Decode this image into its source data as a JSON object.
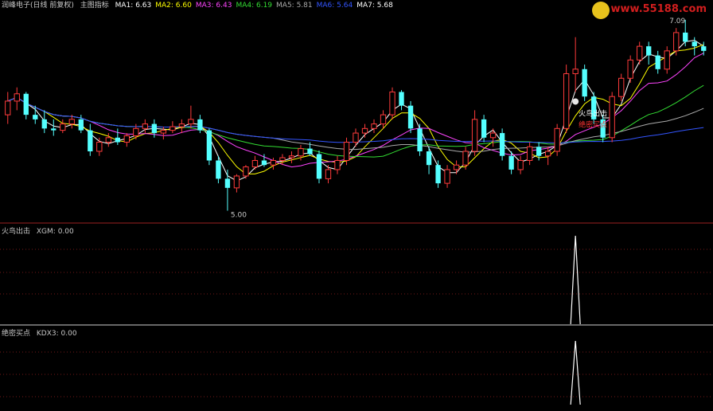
{
  "colors": {
    "up": "#ff3b3b",
    "down": "#54ffff",
    "frame": "#9c2020",
    "text": "#c8c8c8",
    "ma1": "#ffffff",
    "ma2": "#ffff00",
    "ma3": "#ff44ff",
    "ma4": "#33dd33",
    "ma5": "#aaaaaa",
    "ma6": "#3355ff",
    "ma7": "#ffffff",
    "signal": "#ffffff"
  },
  "header": {
    "stock": "润峰电子(日线 前复权)",
    "indicator": "主图指标",
    "ma_labels": [
      {
        "text": "MA1: 6.63",
        "color": "#ffffff"
      },
      {
        "text": "MA2: 6.60",
        "color": "#ffff00"
      },
      {
        "text": "MA3: 6.43",
        "color": "#ff44ff"
      },
      {
        "text": "MA4: 6.19",
        "color": "#33dd33"
      },
      {
        "text": "MA5: 5.81",
        "color": "#aaaaaa"
      },
      {
        "text": "MA6: 5.64",
        "color": "#3355ff"
      },
      {
        "text": "MA7: 5.68",
        "color": "#ffffff"
      }
    ]
  },
  "watermark": "www.55188.com",
  "annotations": {
    "high_label": "7.09",
    "low_label": "5.00",
    "signal1_label": "火鸟出击",
    "signal2_label": "绝密买点"
  },
  "panels": {
    "sub1": {
      "name": "火鸟出击",
      "value_label": "XGM: 0.00"
    },
    "sub2": {
      "name": "绝密买点",
      "value_label": "KDX3: 0.00"
    }
  },
  "chart_data": [
    {
      "type": "candlestick",
      "title": "润峰电子(日线 前复权)",
      "ylim": [
        4.9,
        7.15
      ],
      "candles": [
        [
          6.05,
          6.3,
          5.95,
          6.2
        ],
        [
          6.2,
          6.35,
          6.1,
          6.28
        ],
        [
          6.28,
          6.3,
          6.0,
          6.05
        ],
        [
          6.05,
          6.15,
          5.95,
          6.0
        ],
        [
          6.0,
          6.1,
          5.85,
          5.9
        ],
        [
          5.9,
          6.0,
          5.82,
          5.88
        ],
        [
          5.88,
          6.0,
          5.85,
          5.95
        ],
        [
          5.95,
          6.05,
          5.9,
          6.0
        ],
        [
          6.0,
          6.05,
          5.85,
          5.88
        ],
        [
          5.88,
          5.95,
          5.6,
          5.65
        ],
        [
          5.65,
          5.8,
          5.6,
          5.75
        ],
        [
          5.75,
          5.85,
          5.7,
          5.8
        ],
        [
          5.8,
          5.9,
          5.72,
          5.75
        ],
        [
          5.75,
          5.85,
          5.7,
          5.82
        ],
        [
          5.82,
          5.95,
          5.78,
          5.9
        ],
        [
          5.9,
          6.0,
          5.85,
          5.95
        ],
        [
          5.95,
          6.0,
          5.8,
          5.85
        ],
        [
          5.85,
          5.92,
          5.78,
          5.88
        ],
        [
          5.88,
          5.98,
          5.85,
          5.92
        ],
        [
          5.92,
          6.0,
          5.85,
          5.95
        ],
        [
          5.95,
          6.15,
          5.9,
          6.0
        ],
        [
          6.0,
          6.05,
          5.85,
          5.88
        ],
        [
          5.88,
          5.9,
          5.5,
          5.55
        ],
        [
          5.55,
          5.6,
          5.3,
          5.35
        ],
        [
          5.35,
          5.45,
          5.0,
          5.25
        ],
        [
          5.25,
          5.4,
          5.2,
          5.38
        ],
        [
          5.38,
          5.5,
          5.35,
          5.48
        ],
        [
          5.48,
          5.6,
          5.45,
          5.55
        ],
        [
          5.55,
          5.62,
          5.48,
          5.5
        ],
        [
          5.5,
          5.58,
          5.45,
          5.55
        ],
        [
          5.55,
          5.62,
          5.5,
          5.58
        ],
        [
          5.58,
          5.65,
          5.52,
          5.6
        ],
        [
          5.6,
          5.72,
          5.55,
          5.68
        ],
        [
          5.68,
          5.75,
          5.6,
          5.62
        ],
        [
          5.62,
          5.66,
          5.3,
          5.35
        ],
        [
          5.35,
          5.5,
          5.3,
          5.45
        ],
        [
          5.45,
          5.6,
          5.4,
          5.55
        ],
        [
          5.55,
          5.8,
          5.5,
          5.75
        ],
        [
          5.75,
          5.9,
          5.7,
          5.85
        ],
        [
          5.85,
          5.95,
          5.8,
          5.9
        ],
        [
          5.9,
          6.0,
          5.85,
          5.95
        ],
        [
          5.95,
          6.1,
          5.9,
          6.05
        ],
        [
          6.05,
          6.35,
          6.0,
          6.3
        ],
        [
          6.3,
          6.32,
          6.1,
          6.15
        ],
        [
          6.15,
          6.2,
          5.85,
          5.9
        ],
        [
          5.9,
          5.95,
          5.6,
          5.65
        ],
        [
          5.65,
          5.7,
          5.4,
          5.5
        ],
        [
          5.5,
          5.55,
          5.25,
          5.3
        ],
        [
          5.3,
          5.5,
          5.25,
          5.45
        ],
        [
          5.45,
          5.55,
          5.4,
          5.5
        ],
        [
          5.5,
          5.7,
          5.45,
          5.65
        ],
        [
          5.65,
          6.1,
          5.6,
          6.0
        ],
        [
          6.0,
          6.05,
          5.75,
          5.8
        ],
        [
          5.8,
          5.9,
          5.7,
          5.85
        ],
        [
          5.85,
          5.9,
          5.55,
          5.6
        ],
        [
          5.6,
          5.65,
          5.4,
          5.45
        ],
        [
          5.45,
          5.6,
          5.4,
          5.55
        ],
        [
          5.55,
          5.75,
          5.5,
          5.7
        ],
        [
          5.7,
          5.75,
          5.55,
          5.6
        ],
        [
          5.6,
          5.7,
          5.5,
          5.65
        ],
        [
          5.65,
          5.95,
          5.6,
          5.9
        ],
        [
          5.9,
          6.6,
          5.85,
          6.5
        ],
        [
          6.5,
          6.9,
          6.3,
          6.55
        ],
        [
          6.55,
          6.6,
          6.2,
          6.25
        ],
        [
          6.25,
          6.3,
          5.95,
          6.0
        ],
        [
          6.0,
          6.05,
          5.75,
          5.8
        ],
        [
          5.8,
          6.3,
          5.75,
          6.25
        ],
        [
          6.25,
          6.5,
          6.2,
          6.45
        ],
        [
          6.45,
          6.7,
          6.4,
          6.65
        ],
        [
          6.65,
          6.85,
          6.6,
          6.8
        ],
        [
          6.8,
          6.85,
          6.6,
          6.7
        ],
        [
          6.7,
          6.75,
          6.5,
          6.55
        ],
        [
          6.55,
          6.8,
          6.5,
          6.75
        ],
        [
          6.75,
          7.0,
          6.7,
          6.95
        ],
        [
          6.95,
          7.09,
          6.8,
          6.85
        ],
        [
          6.85,
          6.9,
          6.7,
          6.8
        ],
        [
          6.8,
          6.85,
          6.7,
          6.75
        ]
      ],
      "extra_ma": []
    },
    {
      "type": "area",
      "title": "火鸟出击",
      "ylim": [
        0,
        1
      ],
      "signals": [
        0,
        0,
        0,
        0,
        0,
        0,
        0,
        0,
        0,
        0,
        0,
        0,
        0,
        0,
        0,
        0,
        0,
        0,
        0,
        0,
        0,
        0,
        0,
        0,
        0,
        0,
        0,
        0,
        0,
        0,
        0,
        0,
        0,
        0,
        0,
        0,
        0,
        0,
        0,
        0,
        0,
        0,
        0,
        0,
        0,
        0,
        0,
        0,
        0,
        0,
        0,
        0,
        0,
        0,
        0,
        0,
        0,
        0,
        0,
        0,
        0,
        0,
        0,
        0,
        0,
        0,
        0,
        0,
        0,
        0,
        0,
        0,
        0,
        0,
        0,
        0,
        0
      ],
      "peaks": [
        {
          "index": 62,
          "value": 1
        }
      ]
    },
    {
      "type": "area",
      "title": "绝密买点",
      "ylim": [
        0,
        1
      ],
      "peaks": [
        {
          "index": 62,
          "value": 1
        }
      ]
    }
  ]
}
